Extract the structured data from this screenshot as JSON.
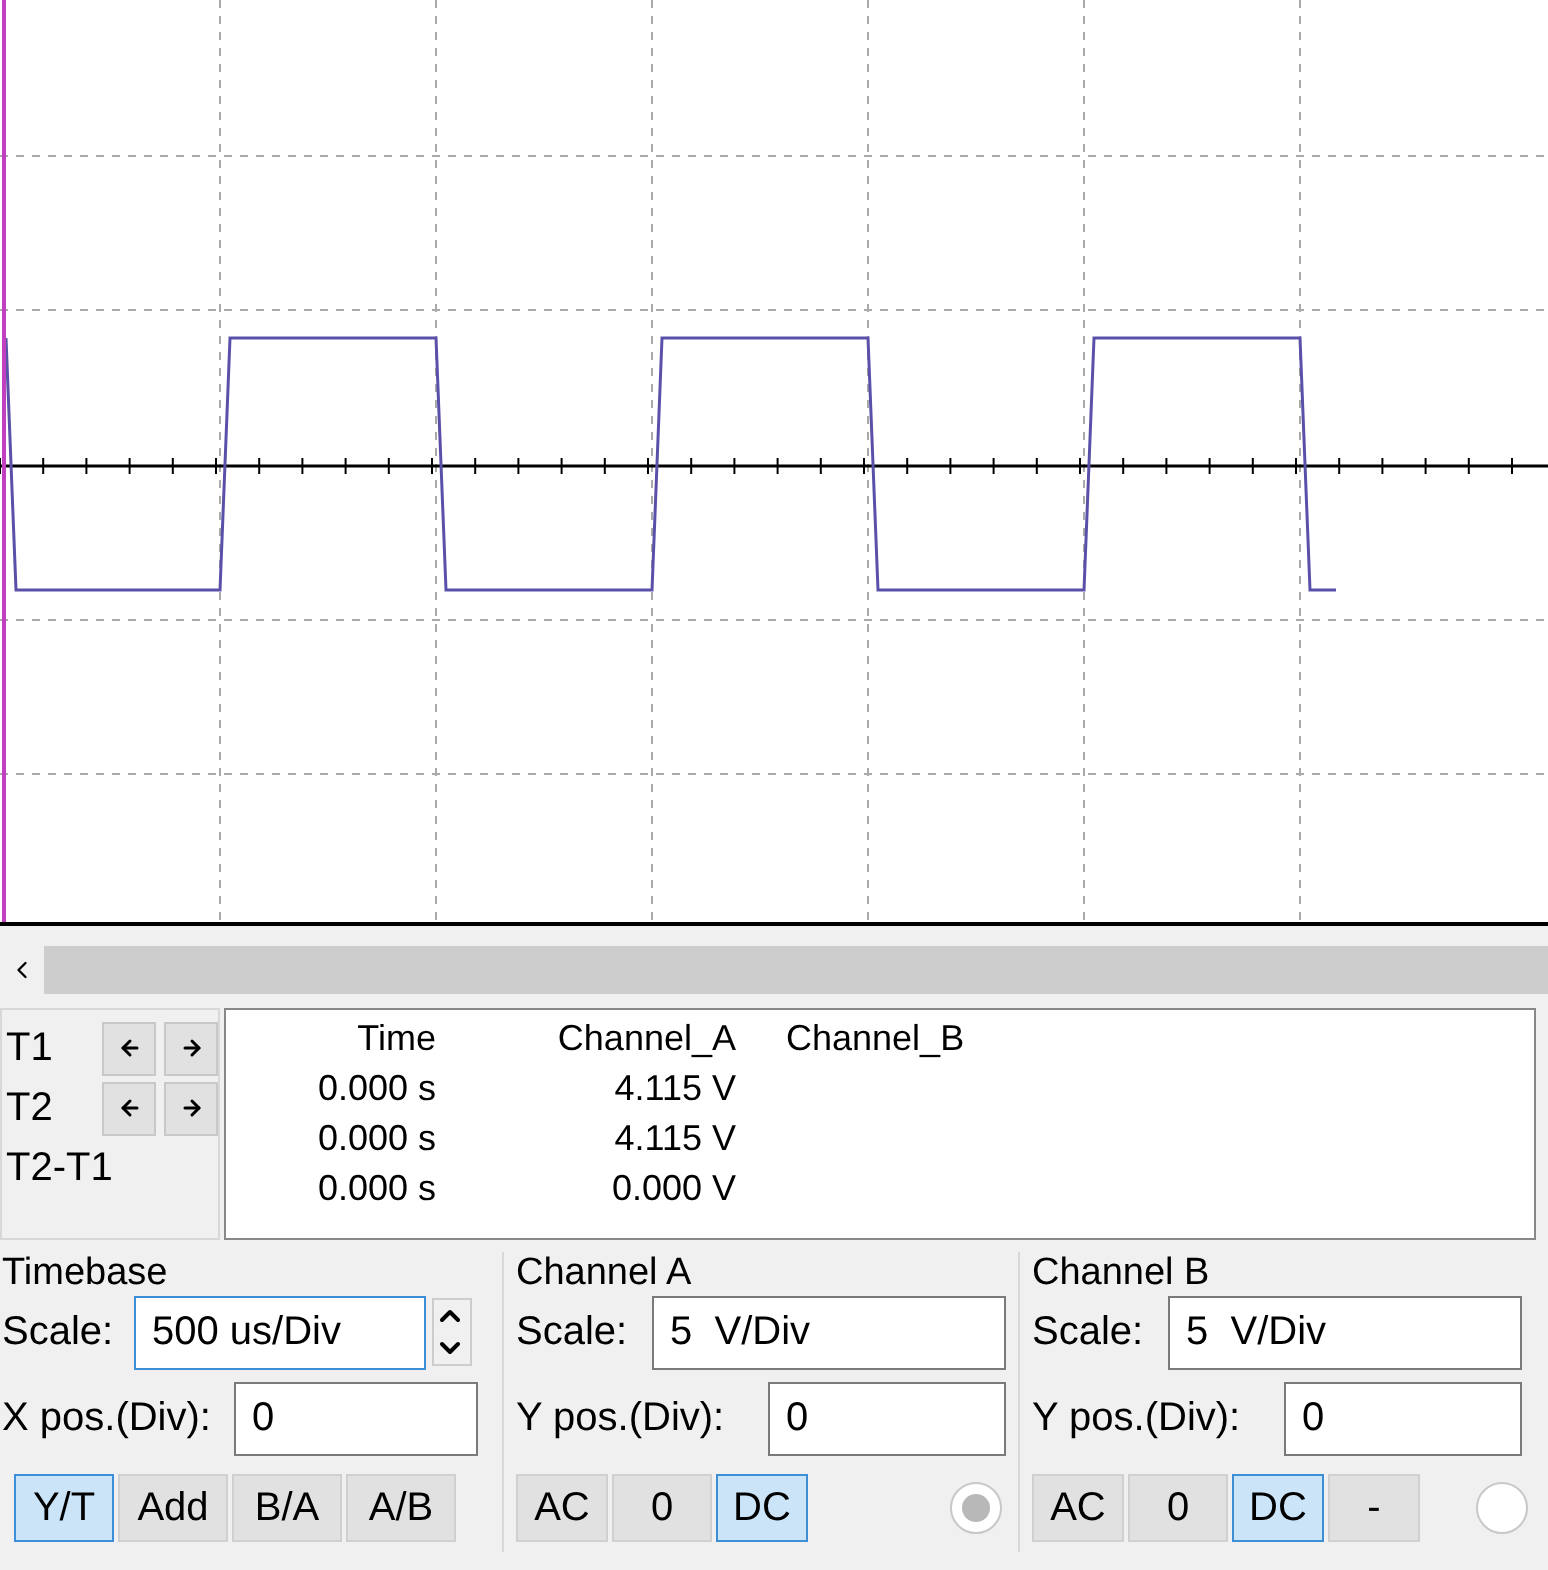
{
  "cursors": {
    "rows": [
      {
        "label": "T1",
        "has_arrows": true
      },
      {
        "label": "T2",
        "has_arrows": true
      },
      {
        "label": "T2-T1",
        "has_arrows": false
      }
    ]
  },
  "readout": {
    "columns": [
      "Time",
      "Channel_A",
      "Channel_B"
    ],
    "rows": [
      [
        "0.000 s",
        "4.115 V",
        ""
      ],
      [
        "0.000 s",
        "4.115 V",
        ""
      ],
      [
        "0.000 s",
        "0.000 V",
        ""
      ]
    ]
  },
  "timebase": {
    "title": "Timebase",
    "scale_label": "Scale:",
    "scale_value": "500 us/Div",
    "pos_label": "X pos.(Div):",
    "pos_value": "0",
    "modes": [
      {
        "label": "Y/T",
        "selected": true
      },
      {
        "label": "Add",
        "selected": false
      },
      {
        "label": "B/A",
        "selected": false
      },
      {
        "label": "A/B",
        "selected": false
      }
    ]
  },
  "channels": [
    {
      "title": "Channel A",
      "scale_label": "Scale:",
      "scale_value": "5  V/Div",
      "pos_label": "Y pos.(Div):",
      "pos_value": "0",
      "couplings": [
        {
          "label": "AC",
          "selected": false
        },
        {
          "label": "0",
          "selected": false
        },
        {
          "label": "DC",
          "selected": true
        }
      ],
      "radio_checked": true
    },
    {
      "title": "Channel B",
      "scale_label": "Scale:",
      "scale_value": "5  V/Div",
      "pos_label": "Y pos.(Div):",
      "pos_value": "0",
      "couplings": [
        {
          "label": "AC",
          "selected": false
        },
        {
          "label": "0",
          "selected": false
        },
        {
          "label": "DC",
          "selected": true
        },
        {
          "label": "-",
          "selected": false
        }
      ],
      "radio_checked": false
    }
  ]
}
